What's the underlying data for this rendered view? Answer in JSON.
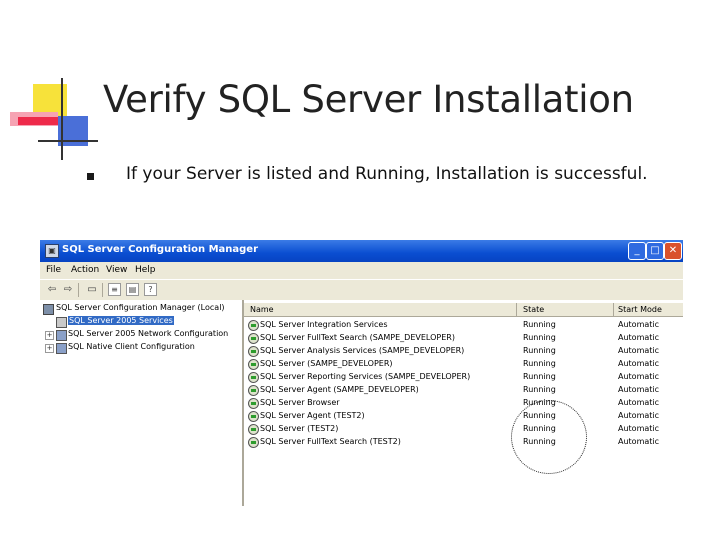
{
  "slide": {
    "title": "Verify SQL Server Installation",
    "bullet": "If your Server is listed and Running, Installation is successful."
  },
  "window": {
    "title": "SQL Server Configuration Manager",
    "menu": [
      "File",
      "Action",
      "View",
      "Help"
    ]
  },
  "tree": {
    "items": [
      {
        "label": "SQL Server Configuration Manager (Local)",
        "selected": false
      },
      {
        "label": "SQL Server 2005 Services",
        "selected": true
      },
      {
        "label": "SQL Server 2005 Network Configuration",
        "selected": false
      },
      {
        "label": "SQL Native Client Configuration",
        "selected": false
      }
    ]
  },
  "list": {
    "columns": [
      "Name",
      "State",
      "Start Mode"
    ],
    "rows": [
      {
        "name": "SQL Server Integration Services",
        "state": "Running",
        "mode": "Automatic"
      },
      {
        "name": "SQL Server FullText Search (SAMPE_DEVELOPER)",
        "state": "Running",
        "mode": "Automatic"
      },
      {
        "name": "SQL Server Analysis Services (SAMPE_DEVELOPER)",
        "state": "Running",
        "mode": "Automatic"
      },
      {
        "name": "SQL Server (SAMPE_DEVELOPER)",
        "state": "Running",
        "mode": "Automatic"
      },
      {
        "name": "SQL Server Reporting Services (SAMPE_DEVELOPER)",
        "state": "Running",
        "mode": "Automatic"
      },
      {
        "name": "SQL Server Agent (SAMPE_DEVELOPER)",
        "state": "Running",
        "mode": "Automatic"
      },
      {
        "name": "SQL Server Browser",
        "state": "Running",
        "mode": "Automatic"
      },
      {
        "name": "SQL Server Agent (TEST2)",
        "state": "Running",
        "mode": "Automatic"
      },
      {
        "name": "SQL Server (TEST2)",
        "state": "Running",
        "mode": "Automatic"
      },
      {
        "name": "SQL Server FullText Search (TEST2)",
        "state": "Running",
        "mode": "Automatic"
      }
    ]
  },
  "colors": {
    "titlebar": "#0a4ed1",
    "selection": "#316ac5",
    "bullet_color": "#1a1a1a"
  }
}
